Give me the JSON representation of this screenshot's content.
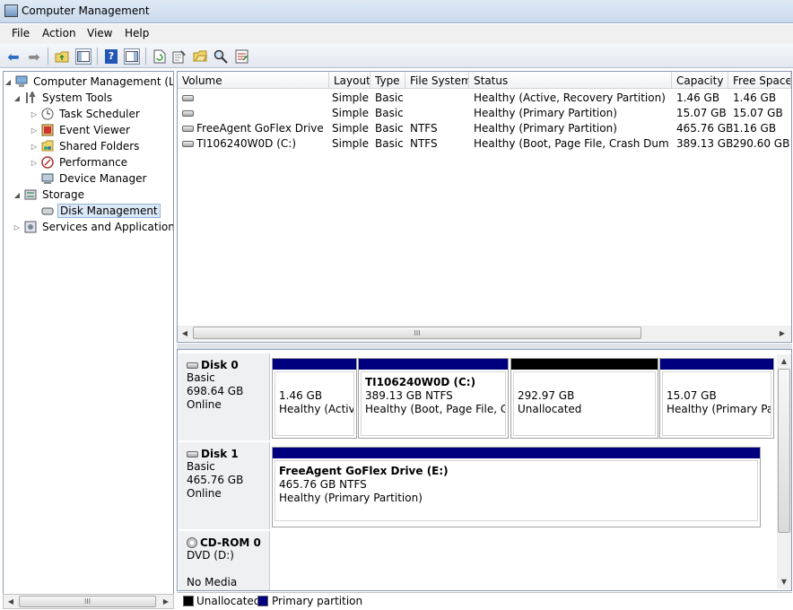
{
  "window": {
    "title": "Computer Management"
  },
  "menu": [
    "File",
    "Action",
    "View",
    "Help"
  ],
  "toolbar": {
    "icons": [
      "back-arrow-icon",
      "forward-arrow-icon",
      "up-folder-icon",
      "show-hide-tree-icon",
      "help-icon",
      "show-hide-action-pane-icon",
      "refresh-icon",
      "properties-icon",
      "open-folder-icon",
      "search-disk-icon",
      "export-list-icon"
    ]
  },
  "tree": {
    "root": "Computer Management (Local",
    "system_tools": "System Tools",
    "task_scheduler": "Task Scheduler",
    "event_viewer": "Event Viewer",
    "shared_folders": "Shared Folders",
    "performance": "Performance",
    "device_manager": "Device Manager",
    "storage": "Storage",
    "disk_management": "Disk Management",
    "services_apps": "Services and Applications"
  },
  "volumes": {
    "columns": [
      "Volume",
      "Layout",
      "Type",
      "File System",
      "Status",
      "Capacity",
      "Free Space"
    ],
    "rows": [
      {
        "volume": "",
        "layout": "Simple",
        "type": "Basic",
        "fs": "",
        "status": "Healthy (Active, Recovery Partition)",
        "capacity": "1.46 GB",
        "free": "1.46 GB"
      },
      {
        "volume": "",
        "layout": "Simple",
        "type": "Basic",
        "fs": "",
        "status": "Healthy (Primary Partition)",
        "capacity": "15.07 GB",
        "free": "15.07 GB"
      },
      {
        "volume": "FreeAgent GoFlex Drive (E:)",
        "layout": "Simple",
        "type": "Basic",
        "fs": "NTFS",
        "status": "Healthy (Primary Partition)",
        "capacity": "465.76 GB",
        "free": "1.16 GB"
      },
      {
        "volume": "TI106240W0D (C:)",
        "layout": "Simple",
        "type": "Basic",
        "fs": "NTFS",
        "status": "Healthy (Boot, Page File, Crash Dump, ...",
        "capacity": "389.13 GB",
        "free": "290.60 GB"
      }
    ]
  },
  "disks": {
    "disk0": {
      "name": "Disk 0",
      "type": "Basic",
      "size": "698.64 GB",
      "state": "Online",
      "partitions": [
        {
          "title": "",
          "size": "1.46 GB",
          "status": "Healthy (Active"
        },
        {
          "title": "TI106240W0D  (C:)",
          "size": "389.13 GB NTFS",
          "status": "Healthy (Boot, Page File, Cras"
        },
        {
          "title": "",
          "size": "292.97 GB",
          "status": "Unallocated"
        },
        {
          "title": "",
          "size": "15.07 GB",
          "status": "Healthy (Primary Part"
        }
      ]
    },
    "disk1": {
      "name": "Disk 1",
      "type": "Basic",
      "size": "465.76 GB",
      "state": "Online",
      "partition": {
        "title": "FreeAgent GoFlex Drive  (E:)",
        "size": "465.76 GB NTFS",
        "status": "Healthy (Primary Partition)"
      }
    },
    "cdrom0": {
      "name": "CD-ROM 0",
      "type": "DVD (D:)",
      "state": "No Media"
    }
  },
  "legend": {
    "unallocated": "Unallocated",
    "primary": "Primary partition"
  },
  "colors": {
    "primary": "#00007f",
    "unallocated": "#000000",
    "selection": "#dbe8f7"
  }
}
